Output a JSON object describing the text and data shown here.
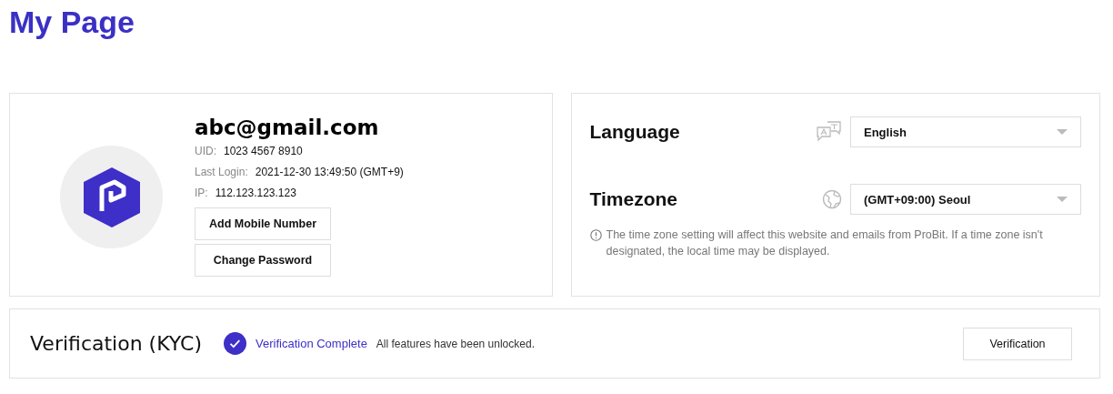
{
  "page_title": "My Page",
  "profile": {
    "email": "abc@gmail.com",
    "fields": [
      {
        "label": "UID:",
        "value": "1023 4567 8910"
      },
      {
        "label": "Last Login:",
        "value": "2021-12-30 13:49:50 (GMT+9)"
      },
      {
        "label": "IP:",
        "value": "112.123.123.123"
      }
    ],
    "buttons": [
      "Add Mobile Number",
      "Change Password"
    ]
  },
  "settings": {
    "rows": [
      {
        "kind": "language",
        "label": "Language",
        "value": "English"
      },
      {
        "kind": "timezone",
        "label": "Timezone",
        "value": "(GMT+09:00) Seoul"
      }
    ],
    "note": "The time zone setting will affect this website and emails from ProBit. If a time zone isn't designated, the local time may be displayed."
  },
  "kyc": {
    "title": "Verification (KYC)",
    "verified": true,
    "status": "Verification Complete",
    "message": "All features have been unlocked.",
    "button": "Verification"
  }
}
